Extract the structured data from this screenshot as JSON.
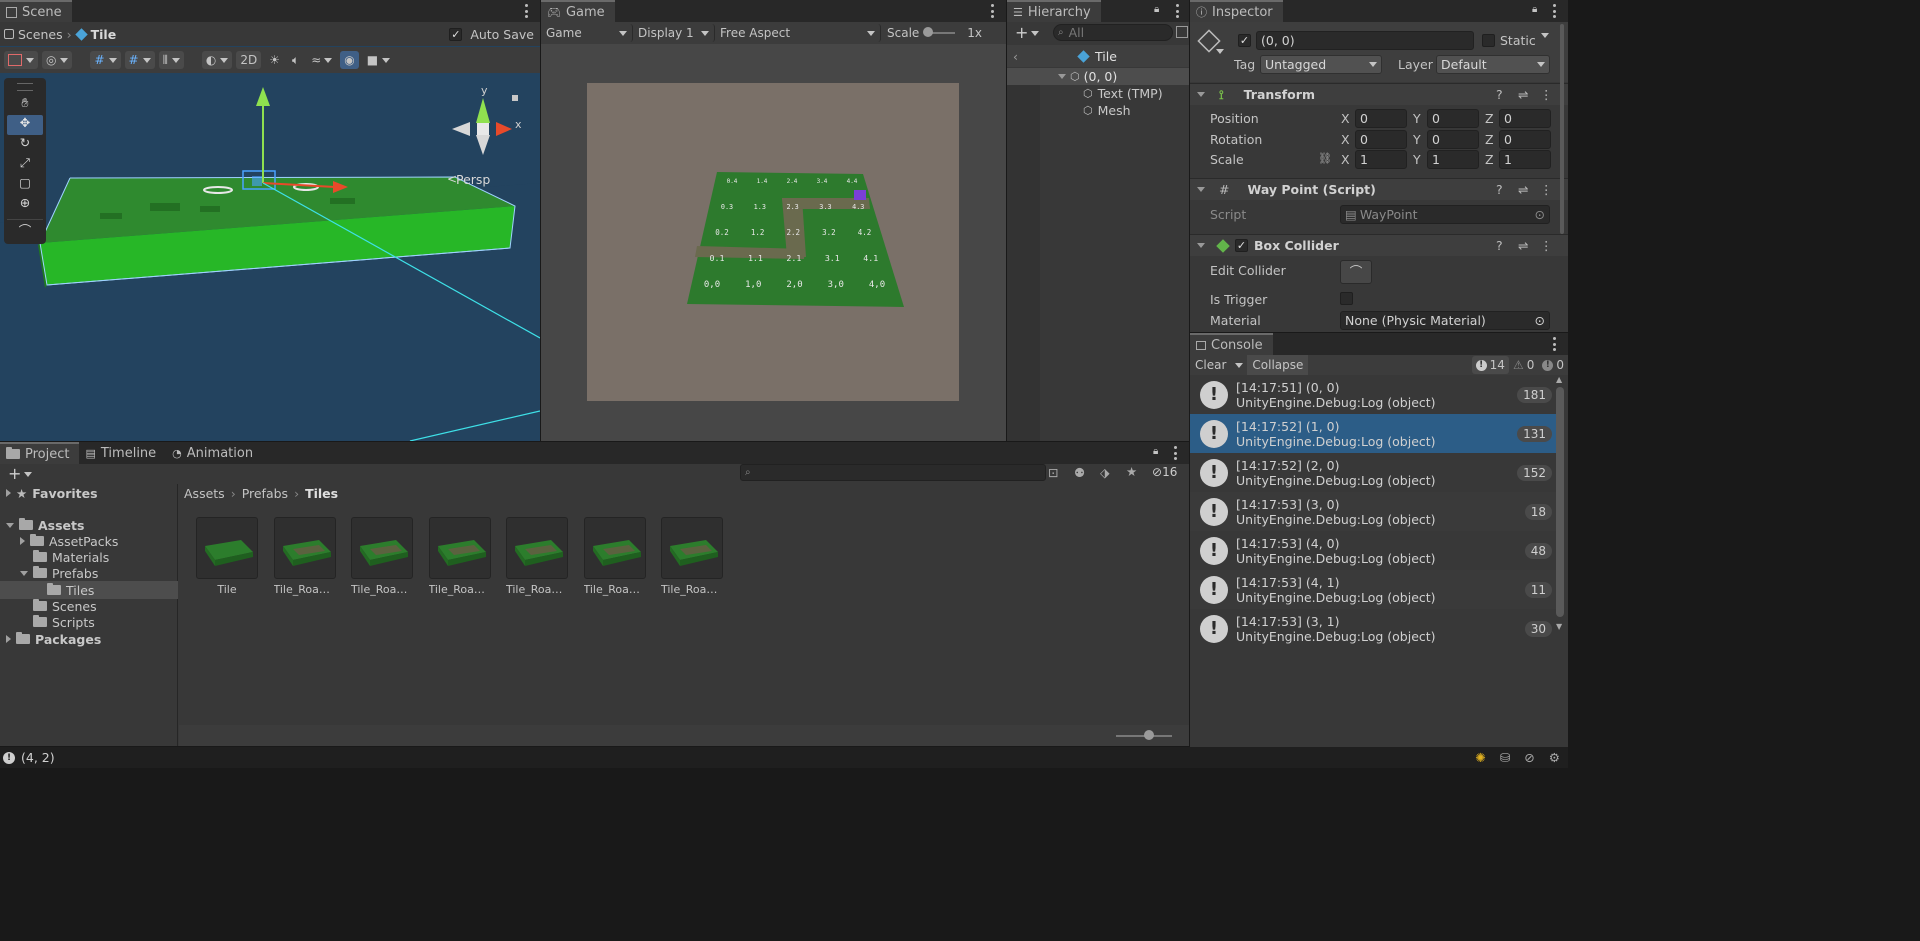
{
  "scene": {
    "tab": "Scene",
    "breadcrumb_root": "Scenes",
    "breadcrumb_current": "Tile",
    "auto_save_label": "Auto Save",
    "mode_2d": "2D",
    "persp_label": "Persp",
    "gizmo_axes": {
      "y": "y",
      "x": "x"
    }
  },
  "game": {
    "tab": "Game",
    "mode": "Game",
    "display": "Display 1",
    "aspect": "Free Aspect",
    "scale_label": "Scale",
    "scale_value": "1x",
    "tile_labels": [
      "0.4",
      "1.4",
      "2.4",
      "3.4",
      "4.4",
      "0.3",
      "1.3",
      "2.3",
      "3.3",
      "4.3",
      "0.2",
      "1.2",
      "2.2",
      "3.2",
      "4.2",
      "0.1",
      "1.1",
      "2.1",
      "3.1",
      "4.1",
      "0,0",
      "1,0",
      "2,0",
      "3,0",
      "4,0"
    ]
  },
  "hierarchy": {
    "tab": "Hierarchy",
    "search_placeholder": "All",
    "root": "Tile",
    "items": [
      "(0, 0)",
      "Text (TMP)",
      "Mesh"
    ]
  },
  "inspector": {
    "tab": "Inspector",
    "object_name": "(0, 0)",
    "static_label": "Static",
    "tag_label": "Tag",
    "tag_value": "Untagged",
    "layer_label": "Layer",
    "layer_value": "Default",
    "transform": {
      "title": "Transform",
      "position_label": "Position",
      "rotation_label": "Rotation",
      "scale_label": "Scale",
      "axis_x": "X",
      "axis_y": "Y",
      "axis_z": "Z",
      "position": [
        "0",
        "0",
        "0"
      ],
      "rotation": [
        "0",
        "0",
        "0"
      ],
      "scale": [
        "1",
        "1",
        "1"
      ]
    },
    "waypoint": {
      "title": "Way Point (Script)",
      "script_label": "Script",
      "script_value": "WayPoint"
    },
    "box_collider": {
      "title": "Box Collider",
      "edit_label": "Edit Collider",
      "trigger_label": "Is Trigger",
      "material_label": "Material",
      "material_value": "None (Physic Material)"
    }
  },
  "console": {
    "tab": "Console",
    "clear_label": "Clear",
    "collapse_label": "Collapse",
    "counts": {
      "log": "14",
      "warn": "0",
      "error": "0"
    },
    "entries": [
      {
        "line1": "[14:17:51] (0, 0)",
        "line2": "UnityEngine.Debug:Log (object)",
        "count": "181"
      },
      {
        "line1": "[14:17:52] (1, 0)",
        "line2": "UnityEngine.Debug:Log (object)",
        "count": "131"
      },
      {
        "line1": "[14:17:52] (2, 0)",
        "line2": "UnityEngine.Debug:Log (object)",
        "count": "152"
      },
      {
        "line1": "[14:17:53] (3, 0)",
        "line2": "UnityEngine.Debug:Log (object)",
        "count": "18"
      },
      {
        "line1": "[14:17:53] (4, 0)",
        "line2": "UnityEngine.Debug:Log (object)",
        "count": "48"
      },
      {
        "line1": "[14:17:53] (4, 1)",
        "line2": "UnityEngine.Debug:Log (object)",
        "count": "11"
      },
      {
        "line1": "[14:17:53] (3, 1)",
        "line2": "UnityEngine.Debug:Log (object)",
        "count": "30"
      }
    ]
  },
  "project": {
    "tabs": [
      "Project",
      "Timeline",
      "Animation"
    ],
    "hidden_count": "16",
    "favorites": "Favorites",
    "assets": "Assets",
    "folders": [
      "AssetPacks",
      "Materials",
      "Prefabs",
      "Tiles",
      "Scenes",
      "Scripts"
    ],
    "packages": "Packages",
    "breadcrumb": [
      "Assets",
      "Prefabs",
      "Tiles"
    ],
    "items": [
      "Tile",
      "Tile_RoadC...",
      "Tile_RoadC...",
      "Tile_RoadC...",
      "Tile_RoadC...",
      "Tile_RoadS...",
      "Tile_RoadS..."
    ]
  },
  "status_bar": {
    "message": "(4, 2)"
  },
  "colors": {
    "accent": "#2c5d87",
    "selected_row": "#2c5d87",
    "grass": "#2f8a2f",
    "sky": "#23435f"
  }
}
